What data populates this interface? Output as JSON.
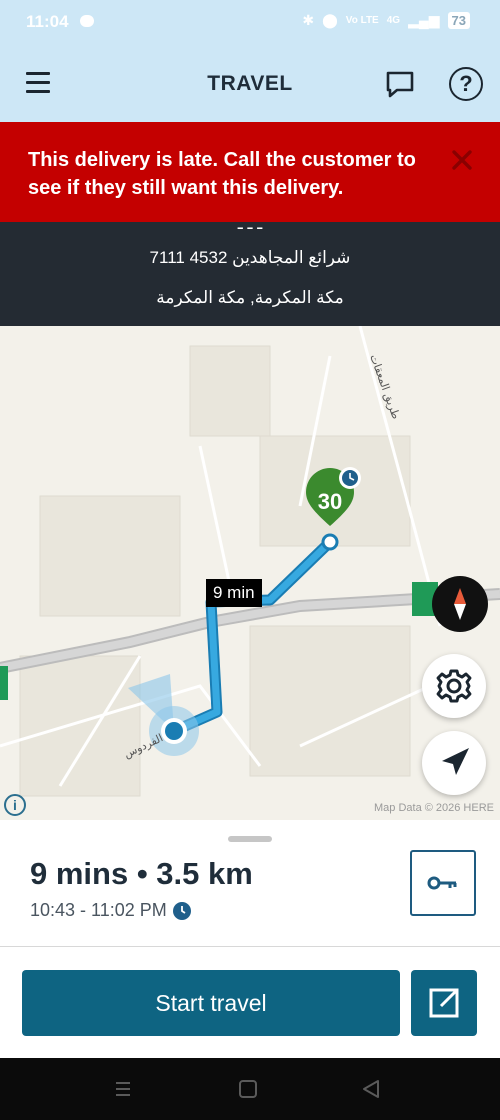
{
  "status_bar": {
    "time": "11:04",
    "network": "Vo LTE",
    "signal": "4G",
    "battery": "73"
  },
  "header": {
    "title": "TRAVEL",
    "icons": [
      "menu-icon",
      "chat-icon",
      "help-icon"
    ]
  },
  "alert": {
    "message": "This delivery is late. Call the customer to see if they still want this delivery.",
    "close_icon": "close-icon",
    "color": "#c40000"
  },
  "address": {
    "line1": "شرائع المجاهدين 4532  7111",
    "line2": "مكة المكرمة, مكة المكرمة"
  },
  "map": {
    "eta_label": "9 min",
    "stop_number": "30",
    "road_label_1": "طريق المعقات",
    "road_label_2": "الفردوس",
    "attribution": "Map Data © 2026 HERE",
    "info_icon": "i",
    "route_color": "#37a9e0",
    "stop_marker_color": "#3b8a2e"
  },
  "summary": {
    "duration_distance": "9 mins • 3.5 km",
    "time_window": "10:43 - 11:02 PM"
  },
  "actions": {
    "start_label": "Start travel"
  },
  "colors": {
    "accent": "#0e6482",
    "header_bg": "#cde7f6",
    "address_bg": "#242b33"
  }
}
